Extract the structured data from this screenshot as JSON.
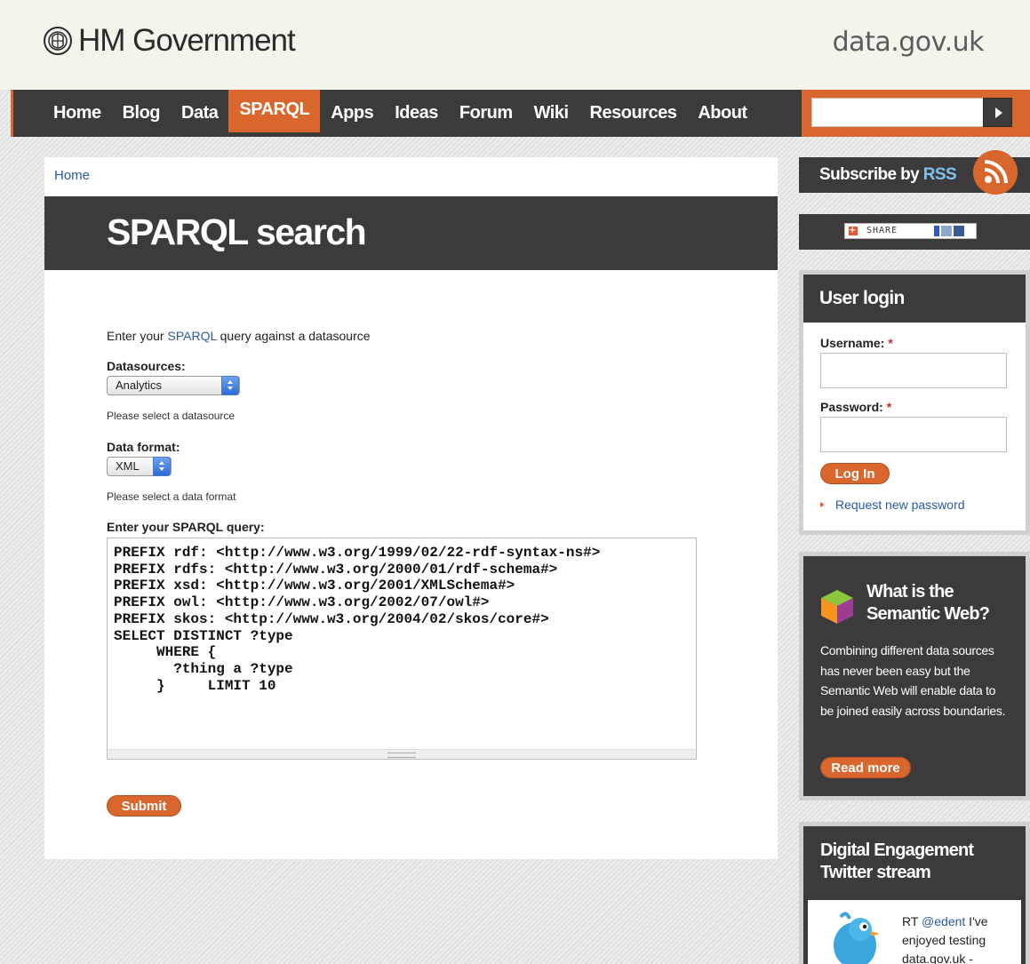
{
  "header": {
    "logo_text": "HM Government",
    "site_name": "data.gov.uk"
  },
  "nav": {
    "items": [
      {
        "label": "Home"
      },
      {
        "label": "Blog"
      },
      {
        "label": "Data"
      },
      {
        "label": "SPARQL",
        "active": true
      },
      {
        "label": "Apps"
      },
      {
        "label": "Ideas"
      },
      {
        "label": "Forum"
      },
      {
        "label": "Wiki"
      },
      {
        "label": "Resources"
      },
      {
        "label": "About"
      }
    ],
    "search_value": ""
  },
  "main": {
    "breadcrumb": "Home",
    "title": "SPARQL search",
    "intro_prefix": "Enter your ",
    "intro_link": "SPARQL",
    "intro_suffix": " query against a datasource",
    "datasource_label": "Datasources:",
    "datasource_value": "Analytics",
    "datasource_help": "Please select a datasource",
    "format_label": "Data format:",
    "format_value": "XML",
    "format_help": "Please select a data format",
    "query_label": "Enter your SPARQL query:",
    "query_text": "PREFIX rdf: <http://www.w3.org/1999/02/22-rdf-syntax-ns#>\nPREFIX rdfs: <http://www.w3.org/2000/01/rdf-schema#>\nPREFIX xsd: <http://www.w3.org/2001/XMLSchema#>\nPREFIX owl: <http://www.w3.org/2002/07/owl#>\nPREFIX skos: <http://www.w3.org/2004/02/skos/core#>\nSELECT DISTINCT ?type\n     WHERE {\n       ?thing a ?type\n     }     LIMIT 10",
    "submit_label": "Submit"
  },
  "sidebar": {
    "rss_prefix": "Subscribe by ",
    "rss_word": "RSS",
    "share_label": "SHARE",
    "login": {
      "title": "User login",
      "username_label": "Username:",
      "password_label": "Password:",
      "required_mark": "*",
      "login_button": "Log In",
      "request_link": "Request new password"
    },
    "semweb": {
      "title_line1": "What is the",
      "title_line2": "Semantic Web?",
      "body": "Combining different data sources has never been easy but the Semantic Web will enable data to be joined easily across boundaries.",
      "read_more": "Read more"
    },
    "twitter": {
      "title_line1": "Digital Engagement",
      "title_line2": "Twitter stream",
      "tweet_prefix": "RT ",
      "tweet_handle": "@edent",
      "tweet_suffix": " I've enjoyed testing data.gov.uk -"
    }
  },
  "colors": {
    "accent": "#d9662c",
    "dark": "#3d3a3b",
    "link": "#2b59a4"
  }
}
